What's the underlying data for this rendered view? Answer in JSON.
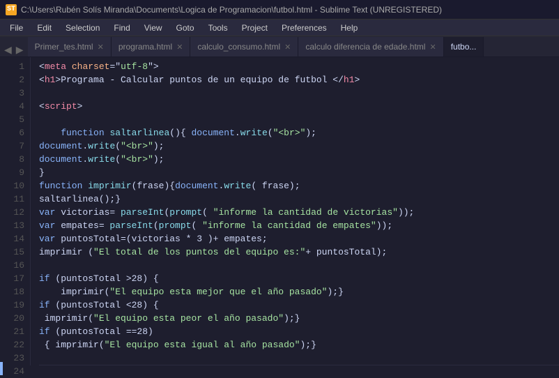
{
  "titlebar": {
    "text": "C:\\Users\\Rubén Solís Miranda\\Documents\\Logica de Programacion\\futbol.html - Sublime Text (UNREGISTERED)",
    "icon": "ST"
  },
  "menubar": {
    "items": [
      "File",
      "Edit",
      "Selection",
      "Find",
      "View",
      "Goto",
      "Tools",
      "Project",
      "Preferences",
      "Help"
    ]
  },
  "tabs": [
    {
      "label": "Primer_tes.html",
      "active": false
    },
    {
      "label": "programa.html",
      "active": false
    },
    {
      "label": "calculo_consumo.html",
      "active": false
    },
    {
      "label": "calculo diferencia de edade.html",
      "active": false
    },
    {
      "label": "futbo...",
      "active": true
    }
  ],
  "lines": [
    {
      "num": 1
    },
    {
      "num": 2
    },
    {
      "num": 3
    },
    {
      "num": 4
    },
    {
      "num": 5
    },
    {
      "num": 6
    },
    {
      "num": 7
    },
    {
      "num": 8
    },
    {
      "num": 9
    },
    {
      "num": 10
    },
    {
      "num": 11
    },
    {
      "num": 12
    },
    {
      "num": 13
    },
    {
      "num": 14
    },
    {
      "num": 15
    },
    {
      "num": 16
    },
    {
      "num": 17
    },
    {
      "num": 18
    },
    {
      "num": 19
    },
    {
      "num": 20
    },
    {
      "num": 21
    },
    {
      "num": 22
    },
    {
      "num": 23
    },
    {
      "num": 24
    }
  ]
}
